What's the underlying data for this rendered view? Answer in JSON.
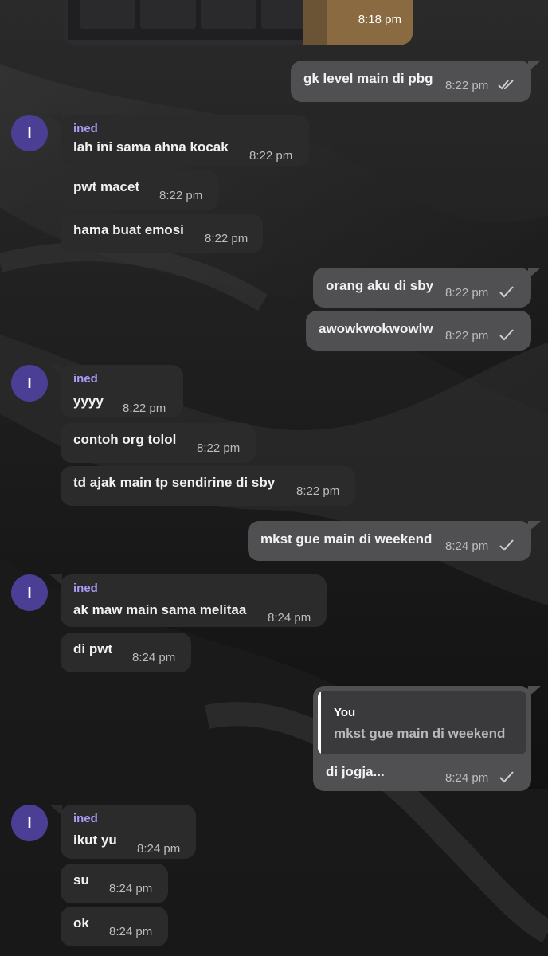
{
  "photo_message": {
    "time": "8:18 pm"
  },
  "contact": {
    "name": "ined",
    "initial": "I"
  },
  "messages": [
    {
      "text": "gk level main di pbg",
      "time": "8:22 pm",
      "status": "read"
    },
    {
      "text": "lah ini sama ahna kocak",
      "time": "8:22 pm"
    },
    {
      "text": "pwt macet",
      "time": "8:22 pm"
    },
    {
      "text": "hama buat emosi",
      "time": "8:22 pm"
    },
    {
      "text": "orang aku di sby",
      "time": "8:22 pm",
      "status": "sent"
    },
    {
      "text": "awowkwokwowlw",
      "time": "8:22 pm",
      "status": "sent"
    },
    {
      "text": "yyyy",
      "time": "8:22 pm"
    },
    {
      "text": "contoh org tolol",
      "time": "8:22 pm"
    },
    {
      "text": "td ajak main tp sendirine di sby",
      "time": "8:22 pm"
    },
    {
      "text": "mkst gue main di weekend",
      "time": "8:24 pm",
      "status": "sent"
    },
    {
      "text": "ak maw main sama melitaa",
      "time": "8:24 pm"
    },
    {
      "text": "di pwt",
      "time": "8:24 pm"
    },
    {
      "text": "di jogja...",
      "time": "8:24 pm",
      "status": "sent",
      "reply_to": {
        "author": "You",
        "text": "mkst gue main di weekend"
      }
    },
    {
      "text": "ikut yu",
      "time": "8:24 pm"
    },
    {
      "text": "su",
      "time": "8:24 pm"
    },
    {
      "text": "ok",
      "time": "8:24 pm"
    }
  ],
  "colors": {
    "incoming_bubble": "#2b2b2b",
    "outgoing_bubble": "#505052",
    "sender_name": "#a89af5",
    "avatar": "#4a3f94",
    "background": "#141414"
  },
  "icons": {
    "read": "double-check-icon",
    "sent": "check-icon"
  }
}
